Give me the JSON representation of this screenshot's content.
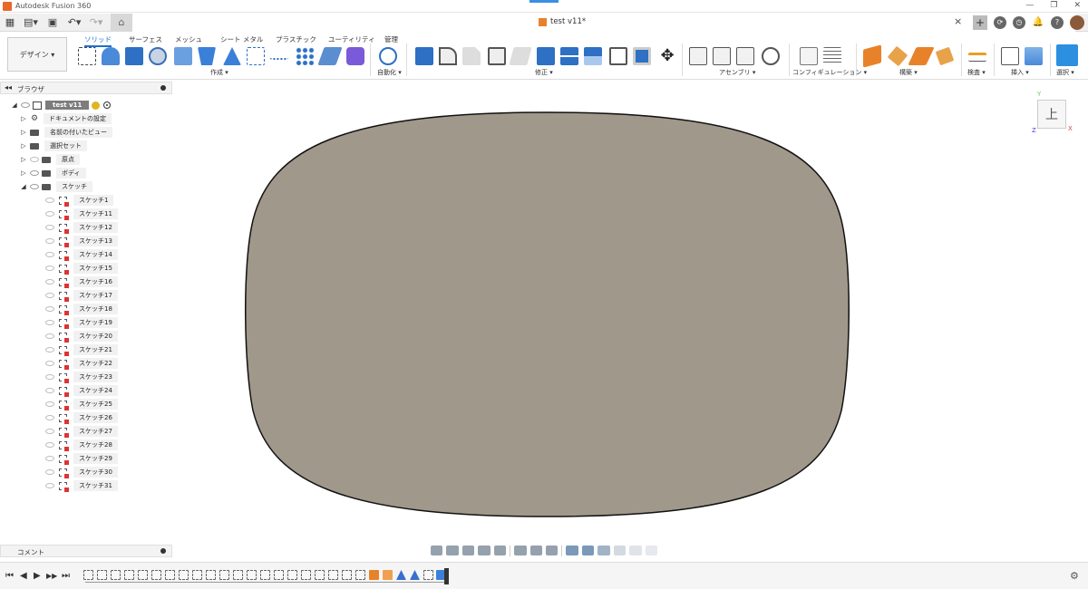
{
  "window": {
    "title": "Autodesk Fusion 360",
    "controls": [
      "—",
      "❐",
      "✕"
    ]
  },
  "quick_access": {
    "grid_icon": "grid-icon",
    "file_icon": "file-icon",
    "save_icon": "save-icon",
    "undo_icon": "undo-icon",
    "redo_icon": "redo-icon",
    "home_icon": "home-icon"
  },
  "document": {
    "tab_title": "test v11*",
    "close": "×",
    "plus": "+"
  },
  "ribbon": {
    "design_button": "デザイン ▾",
    "tabs": [
      "ソリッド",
      "サーフェス",
      "メッシュ",
      "シート メタル",
      "プラスチック",
      "ユーティリティ",
      "管理"
    ],
    "groups": [
      "作成 ▾",
      "自動化 ▾",
      "修正 ▾",
      "アセンブリ ▾",
      "コンフィギュレーション ▾",
      "構築 ▾",
      "検査 ▾",
      "挿入 ▾",
      "選択 ▾"
    ]
  },
  "browser": {
    "header": "ブラウザ",
    "collapse": "◂◂",
    "root": "test v11",
    "nodes": [
      "ドキュメントの設定",
      "名前の付いたビュー",
      "選択セット",
      "原点",
      "ボディ",
      "スケッチ"
    ],
    "sketches": [
      "スケッチ1",
      "スケッチ11",
      "スケッチ12",
      "スケッチ13",
      "スケッチ14",
      "スケッチ15",
      "スケッチ16",
      "スケッチ17",
      "スケッチ18",
      "スケッチ19",
      "スケッチ20",
      "スケッチ21",
      "スケッチ22",
      "スケッチ23",
      "スケッチ24",
      "スケッチ25",
      "スケッチ26",
      "スケッチ27",
      "スケッチ28",
      "スケッチ29",
      "スケッチ30",
      "スケッチ31"
    ]
  },
  "viewcube": {
    "face": "上",
    "y": "Y",
    "x": "X",
    "z": "Z"
  },
  "comments": {
    "label": "コメント"
  },
  "timeline": {
    "controls": [
      "⏮",
      "◀",
      "▶",
      "▶▶",
      "⏭"
    ],
    "gear": "⚙"
  },
  "colors": {
    "accent": "#1e6fd1",
    "body_fill": "#a0988a",
    "body_stroke": "#111111"
  }
}
